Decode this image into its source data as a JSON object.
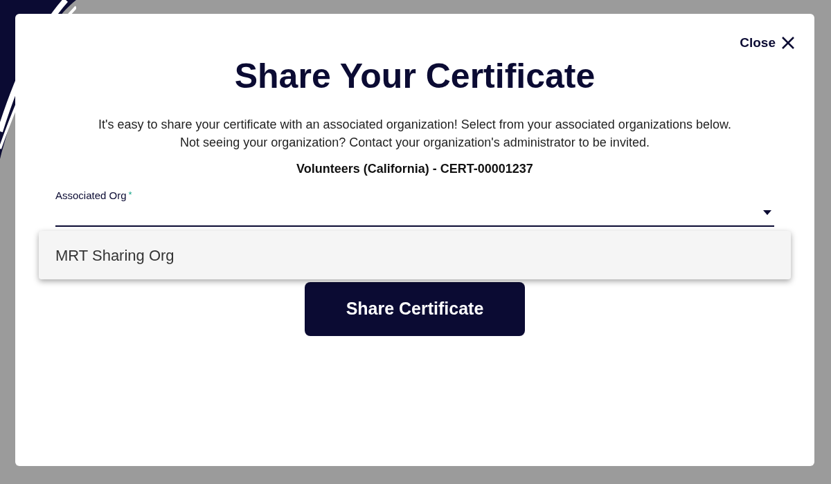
{
  "close": {
    "label": "Close"
  },
  "title": "Share Your Certificate",
  "description": "It's easy to share your certificate with an associated organization! Select from your associated organizations below. Not seeing your organization? Contact your organization's administrator to be invited.",
  "certificate": "Volunteers (California) - CERT-00001237",
  "field": {
    "label": "Associated Org",
    "required_mark": "*",
    "expanded": true
  },
  "options": [
    {
      "label": "MRT Sharing Org",
      "selected": false
    }
  ],
  "button": "Share Certificate"
}
